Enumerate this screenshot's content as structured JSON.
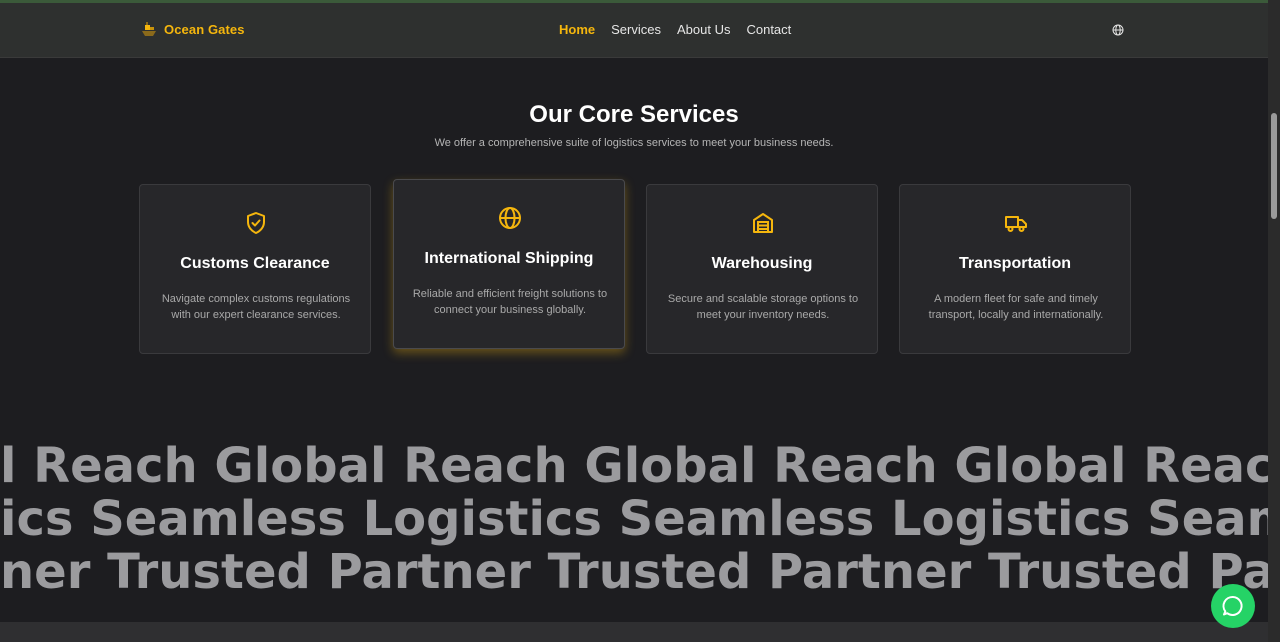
{
  "header": {
    "logo_text": "Ocean Gates",
    "nav": [
      {
        "label": "Home",
        "active": true
      },
      {
        "label": "Services",
        "active": false
      },
      {
        "label": "About Us",
        "active": false
      },
      {
        "label": "Contact",
        "active": false
      }
    ],
    "language_icon": "globe-icon"
  },
  "services": {
    "title": "Our Core Services",
    "subtitle": "We offer a comprehensive suite of logistics services to meet your business needs.",
    "cards": [
      {
        "icon": "shield-check-icon",
        "title": "Customs Clearance",
        "description": "Navigate complex customs regulations with our expert clearance services."
      },
      {
        "icon": "globe-icon",
        "title": "International Shipping",
        "description": "Reliable and efficient freight solutions to connect your business globally."
      },
      {
        "icon": "warehouse-icon",
        "title": "Warehousing",
        "description": "Secure and scalable storage options to meet your inventory needs."
      },
      {
        "icon": "truck-icon",
        "title": "Transportation",
        "description": "A modern fleet for safe and timely transport, locally and internationally."
      }
    ]
  },
  "marquee": {
    "row1": "l Reach Global Reach Global Reach Global Reach Glob",
    "row2": "ics Seamless Logistics Seamless Logistics Seamless Lo",
    "row3": "ner Trusted Partner Trusted Partner Trusted Partner Tr"
  },
  "chat_icon": "whatsapp-icon",
  "colors": {
    "accent": "#f5b60d",
    "background": "#1d1d20",
    "card": "#27272a",
    "chat": "#25d366"
  }
}
